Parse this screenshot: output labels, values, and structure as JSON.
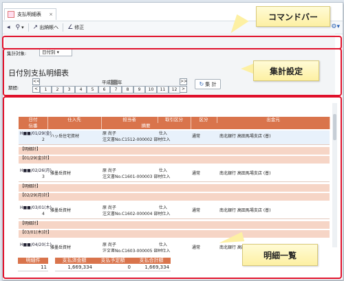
{
  "tab": {
    "title": "支払明細表",
    "close": "×"
  },
  "toolbar": {
    "print": "出納帳へ",
    "edit": "修正"
  },
  "settings": {
    "target_label": "集計対象:",
    "target_value": "日付別",
    "page_title": "日付別支払明細表",
    "period_label": "期間:",
    "year_label": "平成",
    "year_suffix": "年",
    "prev_year": "<<",
    "prev": "<",
    "next_year": ">>",
    "next": ">",
    "months": [
      "1",
      "2",
      "3",
      "4",
      "5",
      "6",
      "7",
      "8",
      "9",
      "10",
      "11",
      "12"
    ],
    "aggregate_button": "集 計"
  },
  "grid": {
    "header_row1": [
      "日付",
      "仕入先",
      "担当者",
      "取引区分",
      "区分",
      "出金元"
    ],
    "header_row2_left": "伝番",
    "header_row2_mid": "摘要",
    "rows": [
      {
        "date": "H■■/01/29(金)",
        "no": "2",
        "supplier": "ハッ岳住宅資材",
        "person": "原 尚子",
        "type": "仕入",
        "kind": "通常",
        "dest": "南北銀行 高田馬場支店 (普)",
        "note": "注文書No.C1512-000002 部材仕入"
      },
      {
        "date": "H■■/02/26(月)",
        "no": "3",
        "supplier": "雅墨岳資材",
        "person": "原 尚子",
        "type": "仕入",
        "kind": "通常",
        "dest": "南北銀行 高田馬場支店 (普)",
        "note": "注文書No.C1601-000003 部材仕入"
      },
      {
        "date": "H■■/03/01(木)",
        "no": "4",
        "supplier": "雅墨岳資材",
        "person": "原 尚子",
        "type": "仕入",
        "kind": "通常",
        "dest": "南北銀行 高田馬場支店 (普)",
        "note": "注文書No.C1602-000004 部材仕入"
      },
      {
        "date": "H■■/04/20(土)",
        "no": "",
        "supplier": "雅墨岳資材",
        "person": "原 尚子",
        "type": "仕入",
        "kind": "通常",
        "dest": "南北銀行 高田馬場支店 (普)",
        "note": "注文書No.C1603-000005 部材仕入"
      }
    ],
    "subtotals": [
      {
        "label": "【明細計】",
        "date": "【01/29(金)計】"
      },
      {
        "label": "【明細計】",
        "date": "【02/29(月)計】"
      },
      {
        "label": "【明細計】",
        "date": "【03/01(木)計】"
      }
    ]
  },
  "footer": {
    "count_label": "明細件",
    "count_value": "11",
    "total_label": "支払済金額",
    "total_value": "1,669,334",
    "planned_label": "支払予定額",
    "planned_value": "0",
    "sum_label": "支払合計額",
    "sum_value": "1,669,334"
  },
  "callouts": {
    "command": "コマンドバー",
    "settings": "集計設定",
    "list": "明細一覧"
  },
  "colors": {
    "highlight": "#e0102a",
    "header": "#d9744c",
    "subtotal": "#f6d5c6",
    "callout": "#fdf0a3"
  }
}
